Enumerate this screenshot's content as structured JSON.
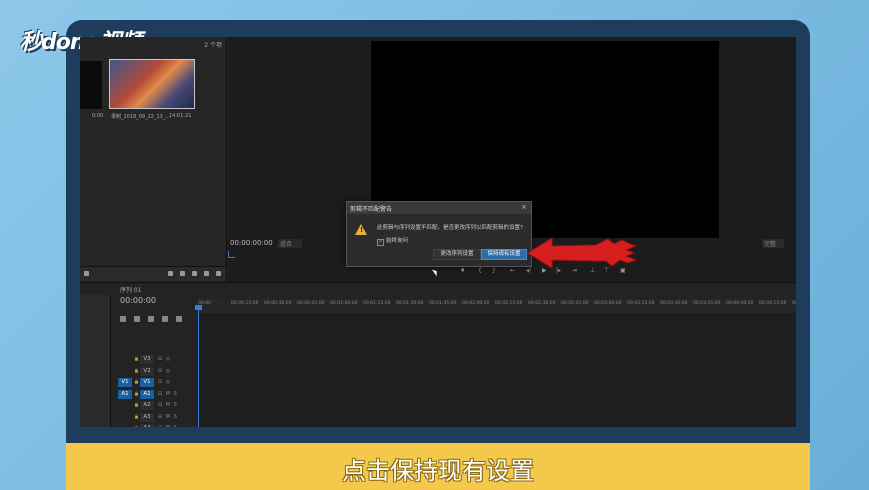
{
  "logo": "秒dong视频",
  "caption": "点击保持现有设置",
  "project": {
    "item_count": "2 个项",
    "clip_name": "录制_2018_09_22_13_...",
    "clip_duration": "14:01:21",
    "left_time": "0:00"
  },
  "monitor": {
    "timecode": "00:00:00:00",
    "fit": "适合",
    "resolution": "完整"
  },
  "timeline": {
    "title": "序列 01",
    "timecode": "00:00:00",
    "ruler": [
      "00:00",
      "00:00:15:00",
      "00:00:30:00",
      "00:00:45:00",
      "00:01:00:00",
      "00:01:15:00",
      "00:01:30:00",
      "00:01:45:00",
      "00:02:00:00",
      "00:02:15:00",
      "00:02:30:00",
      "00:02:45:00",
      "00:03:00:00",
      "00:03:15:00",
      "00:03:30:00",
      "00:03:45:00",
      "00:04:00:00",
      "00:04:15:00",
      "00:04:30:00"
    ],
    "tracks": [
      {
        "src": "",
        "name": "V3",
        "icons": "⊟ ◎"
      },
      {
        "src": "",
        "name": "V2",
        "icons": "⊟ ◎"
      },
      {
        "src": "V1",
        "name": "V1",
        "icons": "⊟ ◎"
      },
      {
        "src": "A1",
        "name": "A1",
        "icons": "⊟ M S"
      },
      {
        "src": "",
        "name": "A2",
        "icons": "⊟ M S"
      },
      {
        "src": "",
        "name": "A3",
        "icons": "⊟ M S"
      },
      {
        "src": "",
        "name": "A4",
        "icons": "⊟ M S"
      }
    ]
  },
  "dialog": {
    "title": "剪辑不匹配警告",
    "message": "此剪辑与序列设置不匹配。是否更改序列以匹配剪辑的设置?",
    "checkbox": "始终询问",
    "btn_change": "更改序列设置",
    "btn_keep": "保持现有设置",
    "close": "×"
  }
}
